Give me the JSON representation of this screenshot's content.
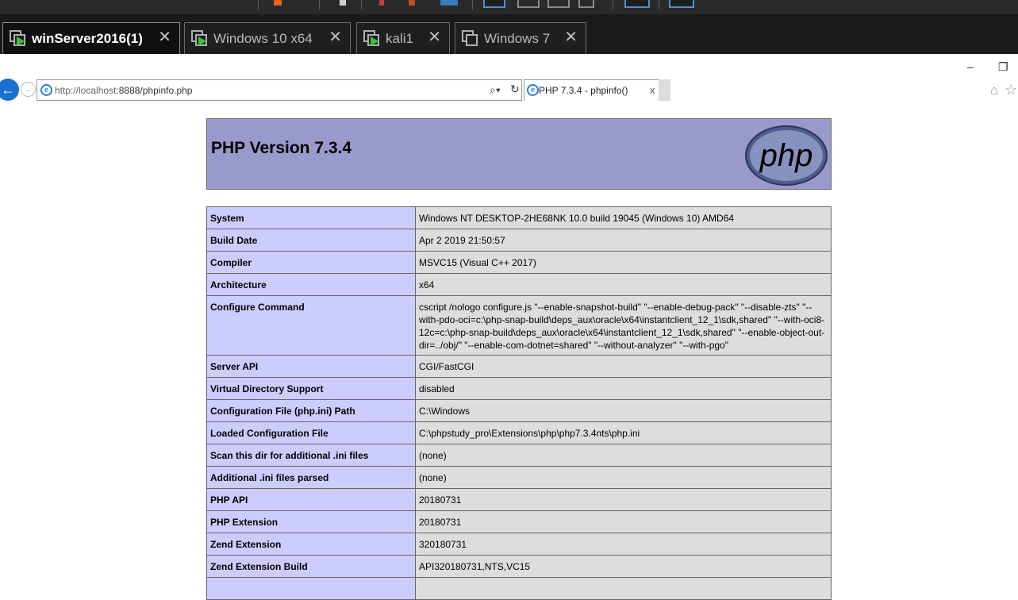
{
  "vm_tabs": [
    {
      "label": "winServer2016(1)",
      "active": true
    },
    {
      "label": "Windows 10 x64",
      "active": false
    },
    {
      "label": "kali1",
      "active": false
    },
    {
      "label": "Windows 7",
      "active": false
    }
  ],
  "tab_close_glyph": "✕",
  "window_controls": {
    "minimize": "–",
    "restore": "❐"
  },
  "browser": {
    "url_host": "http://localhost",
    "url_rest": ":8888/phpinfo.php",
    "tab_title": "PHP 7.3.4 - phpinfo()",
    "tab_close": "x"
  },
  "php": {
    "version_title": "PHP Version 7.3.4",
    "logo_text": "php"
  },
  "rows": [
    {
      "label": "System",
      "value": "Windows NT DESKTOP-2HE68NK 10.0 build 19045 (Windows 10) AMD64"
    },
    {
      "label": "Build Date",
      "value": "Apr 2 2019 21:50:57"
    },
    {
      "label": "Compiler",
      "value": "MSVC15 (Visual C++ 2017)"
    },
    {
      "label": "Architecture",
      "value": "x64"
    },
    {
      "label": "Configure Command",
      "value": "cscript /nologo configure.js \"--enable-snapshot-build\" \"--enable-debug-pack\" \"--disable-zts\" \"--with-pdo-oci=c:\\php-snap-build\\deps_aux\\oracle\\x64\\instantclient_12_1\\sdk,shared\" \"--with-oci8-12c=c:\\php-snap-build\\deps_aux\\oracle\\x64\\instantclient_12_1\\sdk,shared\" \"--enable-object-out-dir=../obj/\" \"--enable-com-dotnet=shared\" \"--without-analyzer\" \"--with-pgo\""
    },
    {
      "label": "Server API",
      "value": "CGI/FastCGI"
    },
    {
      "label": "Virtual Directory Support",
      "value": "disabled"
    },
    {
      "label": "Configuration File (php.ini) Path",
      "value": "C:\\Windows"
    },
    {
      "label": "Loaded Configuration File",
      "value": "C:\\phpstudy_pro\\Extensions\\php\\php7.3.4nts\\php.ini"
    },
    {
      "label": "Scan this dir for additional .ini files",
      "value": "(none)"
    },
    {
      "label": "Additional .ini files parsed",
      "value": "(none)"
    },
    {
      "label": "PHP API",
      "value": "20180731"
    },
    {
      "label": "PHP Extension",
      "value": "20180731"
    },
    {
      "label": "Zend Extension",
      "value": "320180731"
    },
    {
      "label": "Zend Extension Build",
      "value": "API320180731,NTS,VC15"
    }
  ]
}
